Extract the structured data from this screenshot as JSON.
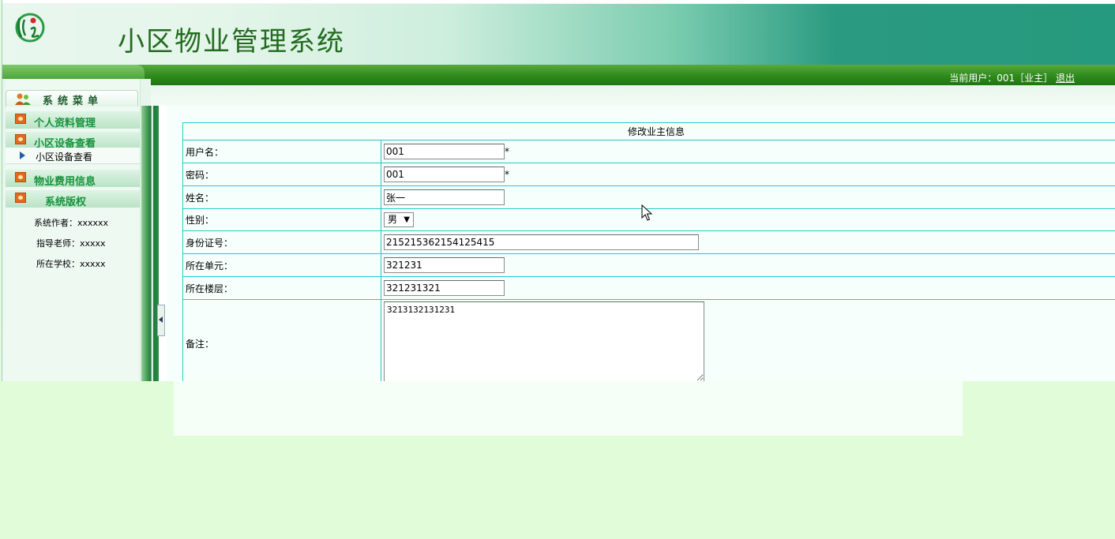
{
  "header": {
    "app_title": "小区物业管理系统",
    "user_prefix": "当前用户：001［业主］",
    "logout_label": "退出"
  },
  "sidebar": {
    "menu_title": "系统菜单",
    "sections": [
      {
        "label": "个人资料管理"
      },
      {
        "label": "小区设备查看",
        "items": [
          {
            "label": "小区设备查看"
          }
        ]
      },
      {
        "label": "物业费用信息"
      },
      {
        "label": "系统版权"
      }
    ],
    "credits": [
      "系统作者：xxxxxx",
      "指导老师：xxxxx",
      "所在学校：xxxxx"
    ]
  },
  "form": {
    "caption": "修改业主信息",
    "required_mark": "*",
    "fields": {
      "username": {
        "label": "用户名：",
        "value": "001"
      },
      "password": {
        "label": "密码：",
        "value": "001"
      },
      "name": {
        "label": "姓名：",
        "value": "张一"
      },
      "gender": {
        "label": "性别：",
        "value": "男"
      },
      "id_number": {
        "label": "身份证号：",
        "value": "215215362154125415"
      },
      "unit": {
        "label": "所在单元：",
        "value": "321231"
      },
      "floor": {
        "label": "所在楼层：",
        "value": "321231321"
      },
      "remark": {
        "label": "备注：",
        "value": "3213132131231"
      }
    }
  },
  "colors": {
    "header_dark": "#269a7e",
    "stripe_green": "#2f8a1c",
    "title_green": "#236b1f",
    "menu_green": "#16933c",
    "table_border": "#28c7c9",
    "page_bg": "#e1fcd8"
  },
  "icons": {
    "logo": "system-logo-icon",
    "menu_tab": "users-icon",
    "section": "orange-square-icon",
    "sub_item": "triangle-arrow-icon",
    "select": "chevron-down-icon"
  }
}
